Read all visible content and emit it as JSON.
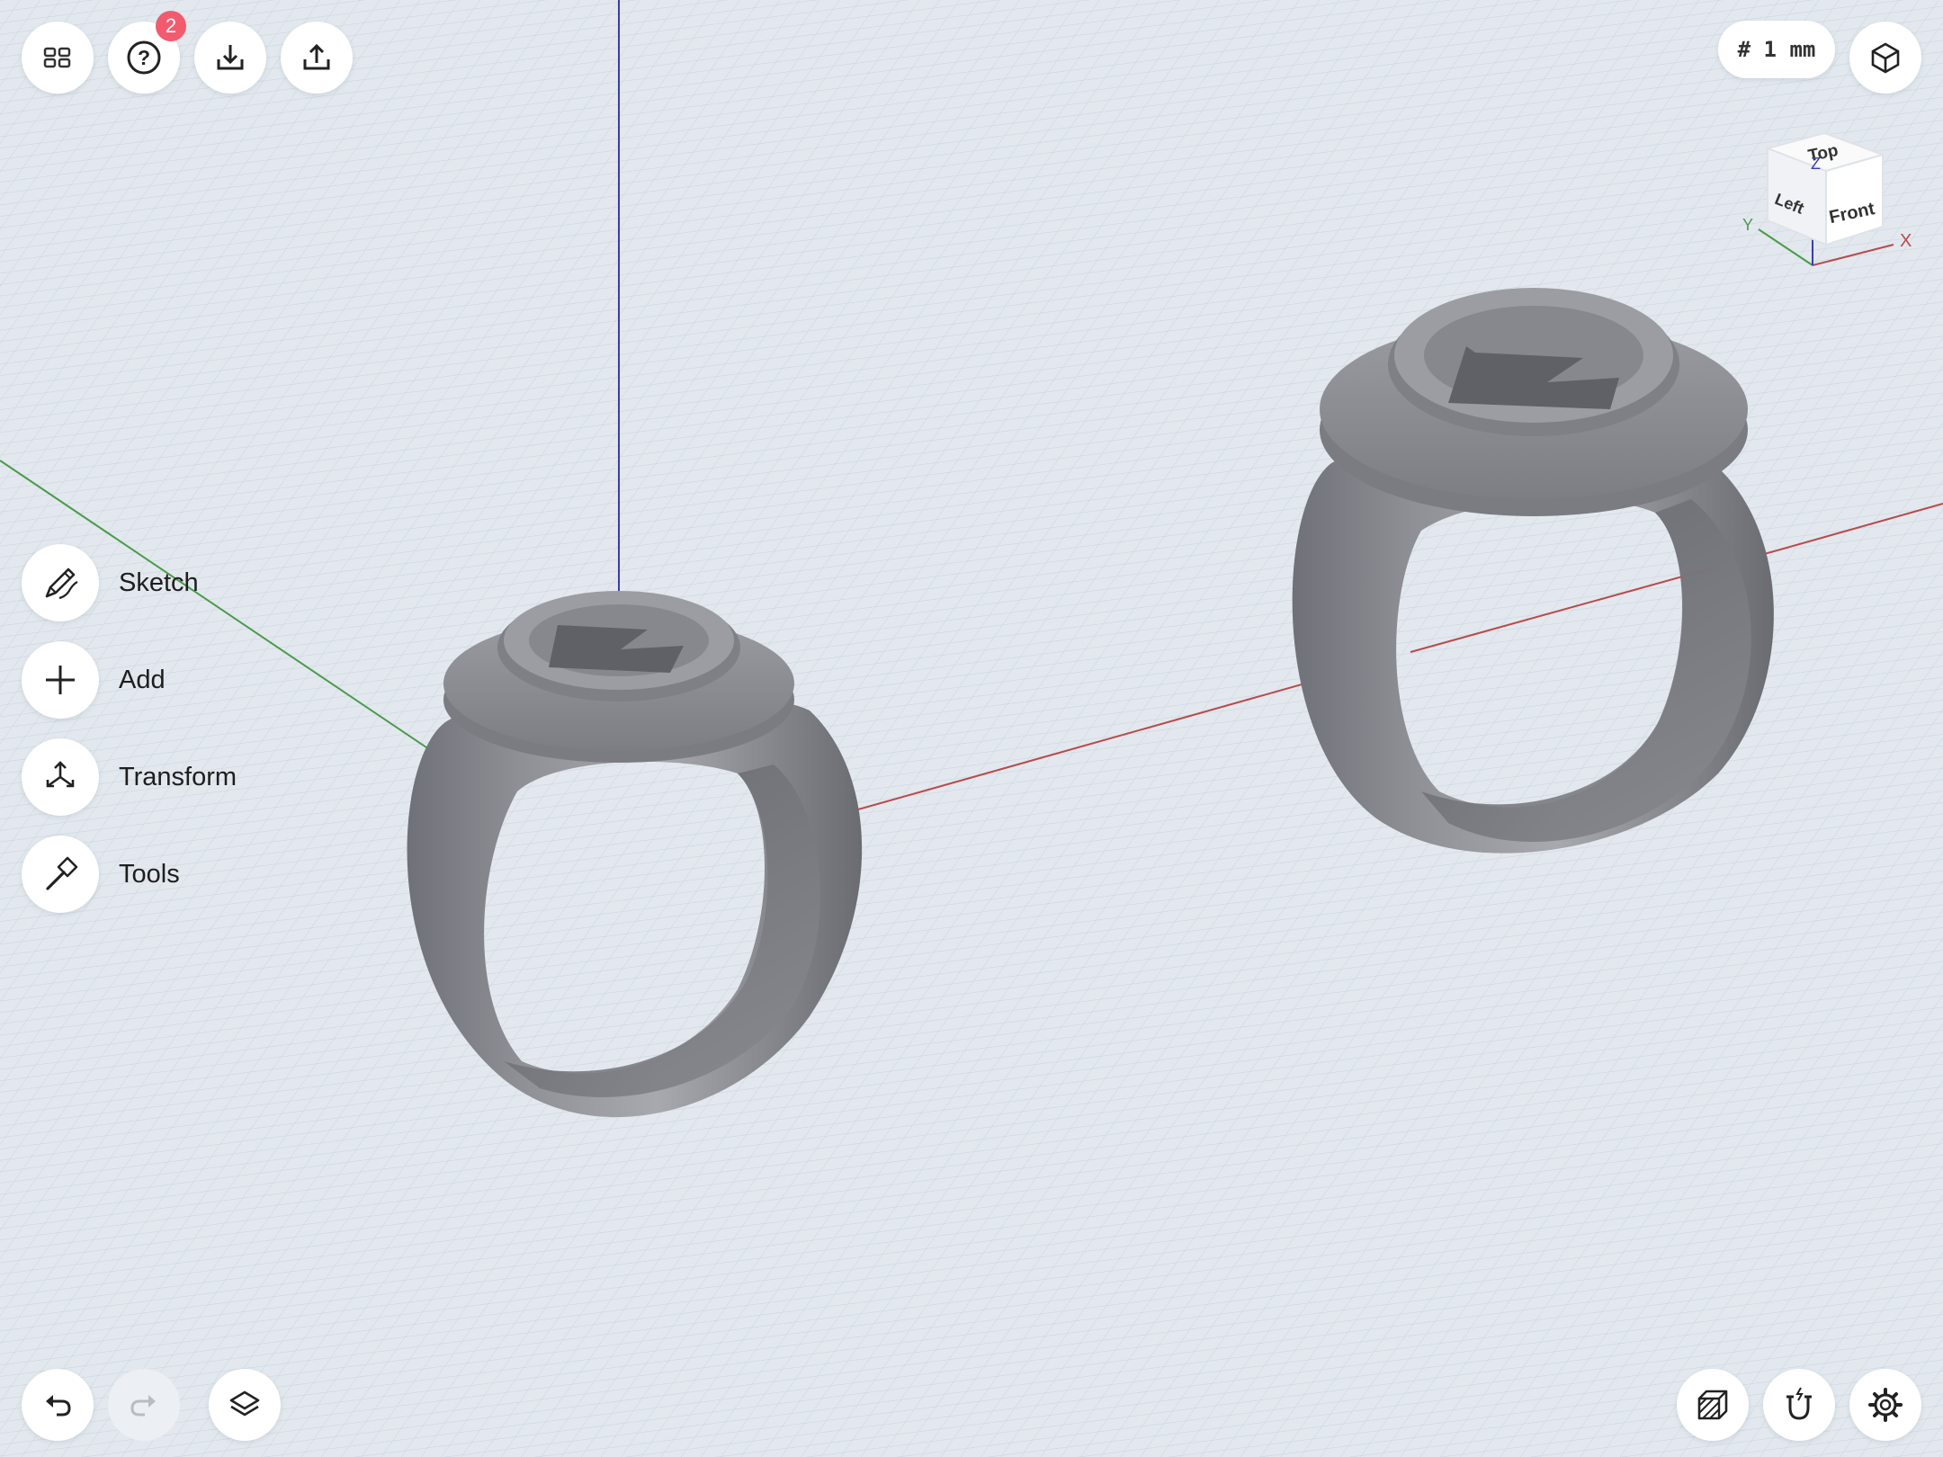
{
  "toolbar_top_left": {
    "help_badge": "2"
  },
  "toolbar_top_right": {
    "grid_size": "# 1 mm"
  },
  "side_menu": [
    {
      "label": "Sketch",
      "icon": "pencil-sketch-icon"
    },
    {
      "label": "Add",
      "icon": "plus-icon"
    },
    {
      "label": "Transform",
      "icon": "transform-arrows-icon"
    },
    {
      "label": "Tools",
      "icon": "hammer-icon"
    }
  ],
  "nav_cube": {
    "top": "Top",
    "left": "Left",
    "front": "Front",
    "axis_x": "X",
    "axis_y": "Y",
    "axis_z": "Z"
  },
  "scene": {
    "objects": [
      "ring",
      "ring"
    ],
    "colors": {
      "background": "#e2e8ee",
      "grid": "#c8d1da",
      "axis_x": "#b94a4a",
      "axis_y": "#4c9a4c",
      "axis_z": "#3b3bb0",
      "model": "#8a8c92"
    }
  }
}
